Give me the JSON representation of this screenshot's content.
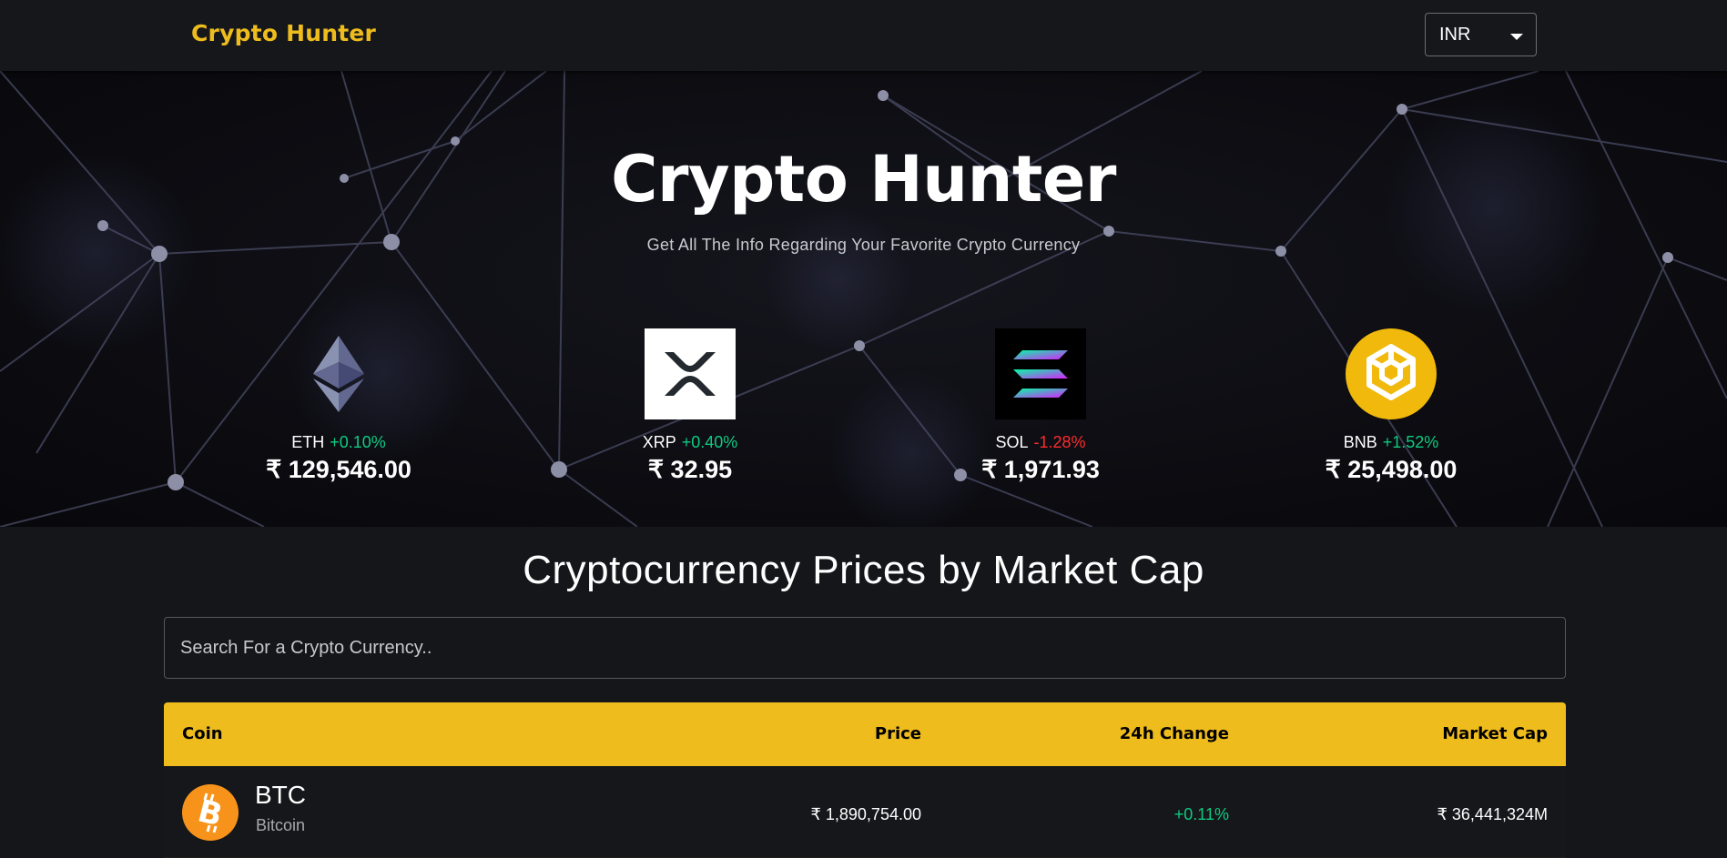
{
  "navbar": {
    "brand": "Crypto Hunter",
    "currency": "INR"
  },
  "hero": {
    "title": "Crypto Hunter",
    "subtitle": "Get All The Info Regarding Your Favorite Crypto Currency",
    "carousel": [
      {
        "symbol": "ETH",
        "change": "+0.10%",
        "price": "₹ 129,546.00",
        "icon": "ethereum-icon"
      },
      {
        "symbol": "XRP",
        "change": "+0.40%",
        "price": "₹ 32.95",
        "icon": "xrp-icon"
      },
      {
        "symbol": "SOL",
        "change": "-1.28%",
        "price": "₹ 1,971.93",
        "icon": "solana-icon"
      },
      {
        "symbol": "BNB",
        "change": "+1.52%",
        "price": "₹ 25,498.00",
        "icon": "bnb-icon"
      }
    ]
  },
  "main": {
    "title": "Cryptocurrency Prices by Market Cap",
    "search_placeholder": "Search For a Crypto Currency..",
    "columns": [
      "Coin",
      "Price",
      "24h Change",
      "Market Cap"
    ],
    "rows": [
      {
        "symbol": "BTC",
        "name": "Bitcoin",
        "price": "₹ 1,890,754.00",
        "change": "+0.11%",
        "market_cap": "₹ 36,441,324M",
        "icon": "bitcoin-icon"
      }
    ]
  },
  "colors": {
    "accent": "#eebc1d",
    "positive": "#0ecb81",
    "negative": "#ff2b2b"
  }
}
